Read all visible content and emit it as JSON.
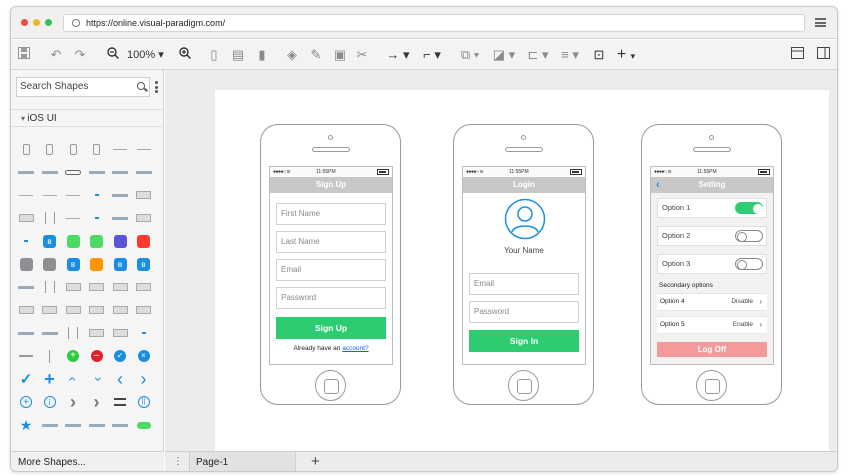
{
  "browser": {
    "url": "https://online.visual-paradigm.com/",
    "dots": [
      "#ed4b3f",
      "#f5b324",
      "#35c15d"
    ]
  },
  "toolbar": {
    "zoom": "100%"
  },
  "sidebar": {
    "search_placeholder": "Search Shapes",
    "category": "iOS UI",
    "more_shapes": "More Shapes..."
  },
  "bottom": {
    "page_tab": "Page-1"
  },
  "phones": {
    "signup": {
      "time": "11:55PM",
      "title": "Sign Up",
      "fields": [
        "First Name",
        "Last Name",
        "Email",
        "Password"
      ],
      "button": "Sign Up",
      "footer_text": "Already have an ",
      "footer_link": "account?"
    },
    "login": {
      "time": "11:55PM",
      "title": "Login",
      "avatar_label": "Your Name",
      "fields": [
        "Email",
        "Password"
      ],
      "button": "Sign In"
    },
    "setting": {
      "time": "11:55PM",
      "title": "Setting",
      "options": [
        {
          "label": "Option 1",
          "on": true
        },
        {
          "label": "Option 2",
          "on": false
        },
        {
          "label": "Option 3",
          "on": false
        }
      ],
      "section": "Secondary options",
      "secondary": [
        {
          "label": "Option 4",
          "value": "Disable"
        },
        {
          "label": "Option 5",
          "value": "Enable"
        }
      ],
      "button": "Log Off"
    }
  },
  "colors": {
    "green": "#2ecc71",
    "red_button": "#f59a9a",
    "blue": "#1a8fe0"
  }
}
